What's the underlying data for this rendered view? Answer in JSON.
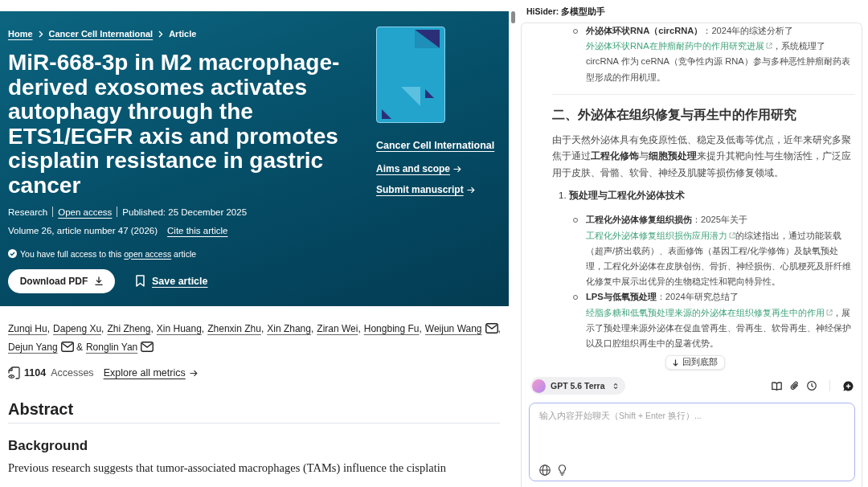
{
  "article_header": {
    "breadcrumb": [
      {
        "label": "Home",
        "kind": "link"
      },
      {
        "label": "Cancer Cell International",
        "kind": "link"
      },
      {
        "label": "Article",
        "kind": "current"
      }
    ],
    "title": "MiR-668-3p in M2 macrophage-derived exosomes activates autophagy through the ETS1/EGFR axis and promotes cisplatin resistance in gastric cancer",
    "meta": [
      {
        "text": "Research",
        "kind": "text"
      },
      {
        "text": "Open access",
        "kind": "link"
      },
      {
        "text": "Published: 25 December 2025",
        "kind": "text"
      }
    ],
    "volume": "Volume 26, article number 47 (2026)",
    "cite_link": "Cite this article",
    "access_notice": {
      "before": "You have full access to this",
      "link": "open access",
      "after": "article"
    },
    "download_button": "Download PDF",
    "save_button": "Save article",
    "journal": {
      "name": "Cancer Cell International",
      "links": [
        "Aims and scope",
        "Submit manuscript"
      ]
    }
  },
  "authors": [
    {
      "name": "Zunqi Hu",
      "corresponding": false,
      "trailing": ","
    },
    {
      "name": "Dapeng Xu",
      "corresponding": false,
      "trailing": ","
    },
    {
      "name": "Zhi Zheng",
      "corresponding": false,
      "trailing": ","
    },
    {
      "name": "Xin Huang",
      "corresponding": false,
      "trailing": ","
    },
    {
      "name": "Zhenxin Zhu",
      "corresponding": false,
      "trailing": ","
    },
    {
      "name": "Xin Zhang",
      "corresponding": false,
      "trailing": ","
    },
    {
      "name": "Ziran Wei",
      "corresponding": false,
      "trailing": ","
    },
    {
      "name": "Hongbing Fu",
      "corresponding": false,
      "trailing": ","
    },
    {
      "name": "Weijun Wang",
      "corresponding": true,
      "trailing": ","
    },
    {
      "name": "Dejun Yang",
      "corresponding": true,
      "trailing": " &"
    },
    {
      "name": "Ronglin Yan",
      "corresponding": true
    }
  ],
  "metrics": {
    "count": "1104",
    "label": "Accesses",
    "link": "Explore all metrics"
  },
  "abstract": {
    "heading": "Abstract",
    "section": {
      "heading": "Background",
      "text": "Previous research suggests that tumor-associated macrophages (TAMs) influence the cisplatin"
    }
  },
  "assistant": {
    "title": "HiSider: 多模型助手",
    "messages": [
      {
        "kind": "bullet",
        "parts": [
          {
            "kind": "bold",
            "text": "外泌体环状RNA（circRNA）"
          },
          {
            "kind": "plain",
            "text": "：2024年的综述分析了"
          },
          {
            "kind": "link",
            "text": "外泌体环状RNA在肿瘤耐药中的作用研究进展"
          },
          {
            "kind": "plain",
            "text": "，系统梳理了 circRNA 作为 ceRNA（竞争性内源 RNA）参与多种恶性肿瘤耐药表型形成的作用机理。"
          }
        ]
      },
      {
        "kind": "divider"
      },
      {
        "kind": "heading",
        "text": "二、外泌体在组织修复与再生中的作用研究"
      },
      {
        "kind": "paragraph",
        "parts": [
          {
            "kind": "plain",
            "text": "由于天然外泌体具有免疫原性低、稳定及低毒等优点，近年来研究多聚焦于通过"
          },
          {
            "kind": "bold",
            "text": "工程化修饰"
          },
          {
            "kind": "plain",
            "text": "与"
          },
          {
            "kind": "bold",
            "text": "细胞预处理"
          },
          {
            "kind": "plain",
            "text": "来提升其靶向性与生物活性，广泛应用于皮肤、骨骼、软骨、神经及肌腱等损伤修复领域。"
          }
        ]
      },
      {
        "kind": "numbered",
        "number": "1.",
        "text": "预处理与工程化外泌体技术",
        "children": [
          {
            "kind": "bullet",
            "parts": [
              {
                "kind": "bold",
                "text": "工程化外泌体修复组织损伤"
              },
              {
                "kind": "plain",
                "text": "：2025年关于"
              },
              {
                "kind": "link",
                "text": "工程化外泌体修复组织损伤应用潜力"
              },
              {
                "kind": "plain",
                "text": "的综述指出，通过功能装载（超声/挤出载药）、表面修饰（基因工程/化学修饰）及缺氧预处理，工程化外泌体在皮肤创伤、骨折、神经损伤、心肌梗死及肝纤维化修复中展示出优异的生物稳定性和靶向特异性。"
              }
            ]
          },
          {
            "kind": "bullet",
            "parts": [
              {
                "kind": "bold",
                "text": "LPS与低氧预处理"
              },
              {
                "kind": "plain",
                "text": "：2024年研究总结了"
              },
              {
                "kind": "link",
                "text": "经脂多糖和低氧预处理来源的外泌体在组织修复再生中的作用"
              },
              {
                "kind": "plain",
                "text": "，展示了预处理来源外泌体在促血管再生、骨再生、软骨再生、神经保护以及口腔组织再生中的显著优势。"
              }
            ]
          }
        ]
      }
    ],
    "scroll_button": "回到底部",
    "model": "GPT 5.6 Terra",
    "input": {
      "placeholder": "输入内容开始聊天（Shift + Enter 换行）..."
    }
  }
}
